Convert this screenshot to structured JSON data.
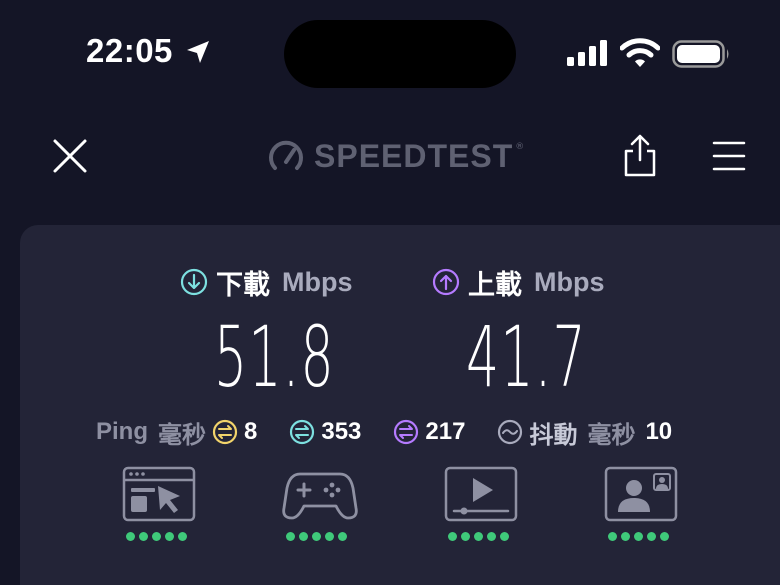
{
  "status_bar": {
    "time": "22:05",
    "icons": [
      "location-arrow-icon",
      "cellular-signal-icon",
      "wifi-icon",
      "battery-icon"
    ]
  },
  "header": {
    "brand": "SPEEDTEST",
    "trademark": "®",
    "icons": [
      "close-icon",
      "speedometer-icon",
      "share-icon",
      "menu-icon"
    ]
  },
  "results": {
    "download": {
      "label": "下載",
      "unit": "Mbps",
      "value": "51.8",
      "icon": "download-arrow-icon",
      "color": "#7de0e0"
    },
    "upload": {
      "label": "上載",
      "unit": "Mbps",
      "value": "41.7",
      "icon": "upload-arrow-icon",
      "color": "#b57bff"
    },
    "ping": {
      "label": "Ping",
      "unit": "毫秒",
      "idle": "8",
      "download": "353",
      "upload": "217",
      "idle_color": "#f2d46b",
      "download_color": "#7de0e0",
      "upload_color": "#b57bff"
    },
    "jitter": {
      "label": "抖動",
      "unit": "毫秒",
      "value": "10"
    }
  },
  "experience": {
    "tiles": [
      {
        "icon": "web-browsing-icon",
        "rating": 5
      },
      {
        "icon": "gaming-controller-icon",
        "rating": 5
      },
      {
        "icon": "video-streaming-icon",
        "rating": 5
      },
      {
        "icon": "video-call-icon",
        "rating": 5
      }
    ],
    "rating_color": "#3fc97a"
  }
}
